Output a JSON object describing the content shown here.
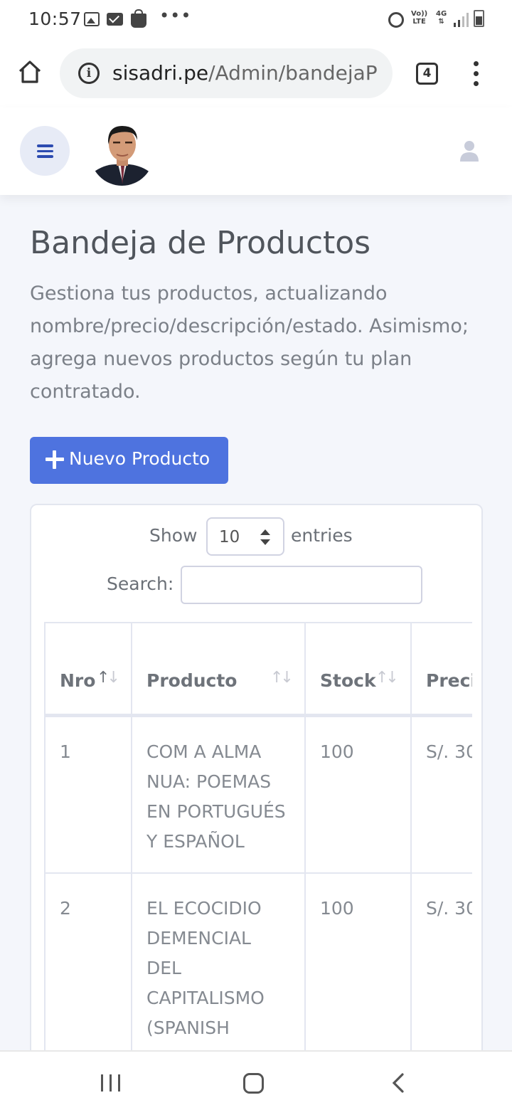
{
  "status_bar": {
    "time": "10:57",
    "volte": "Vo))\nLTE",
    "network": "4G"
  },
  "browser": {
    "url_host": "sisadri.pe",
    "url_path": "/Admin/bandejaP",
    "tab_count": "4"
  },
  "page": {
    "title": "Bandeja de Productos",
    "description": "Gestiona tus productos, actualizando nombre/precio/descripción/estado. Asimismo; agrega nuevos productos según tu plan contratado.",
    "new_button_label": "Nuevo Producto"
  },
  "table_controls": {
    "show_label": "Show",
    "page_length": "10",
    "entries_label": "entries",
    "search_label": "Search:",
    "search_value": ""
  },
  "table": {
    "headers": [
      "Nro",
      "Producto",
      "Stock",
      "Preci"
    ],
    "rows": [
      {
        "nro": "1",
        "producto": "COM A ALMA NUA: POEMAS EN PORTUGUÉS Y ESPAÑOL",
        "stock": "100",
        "precio": "S/. 30"
      },
      {
        "nro": "2",
        "producto": "EL ECOCIDIO DEMENCIAL DEL CAPITALISMO (SPANISH",
        "stock": "100",
        "precio": "S/. 30"
      }
    ]
  },
  "icons": {
    "status": [
      "gallery-icon",
      "mail-icon",
      "shopping-bag-icon",
      "more-dots-icon",
      "alarm-icon",
      "signal-icon",
      "battery-icon"
    ],
    "browser": [
      "home-icon",
      "info-icon",
      "tabs-icon",
      "overflow-menu-icon"
    ],
    "app": [
      "hamburger-icon",
      "user-icon",
      "plus-icon"
    ],
    "nav": [
      "recent-apps-icon",
      "home-circle-icon",
      "back-icon"
    ]
  },
  "colors": {
    "primary": "#4e73df",
    "background": "#f4f6fb",
    "hamburger_bg": "#e7ebf6",
    "hamburger_fg": "#2c4bb0"
  }
}
